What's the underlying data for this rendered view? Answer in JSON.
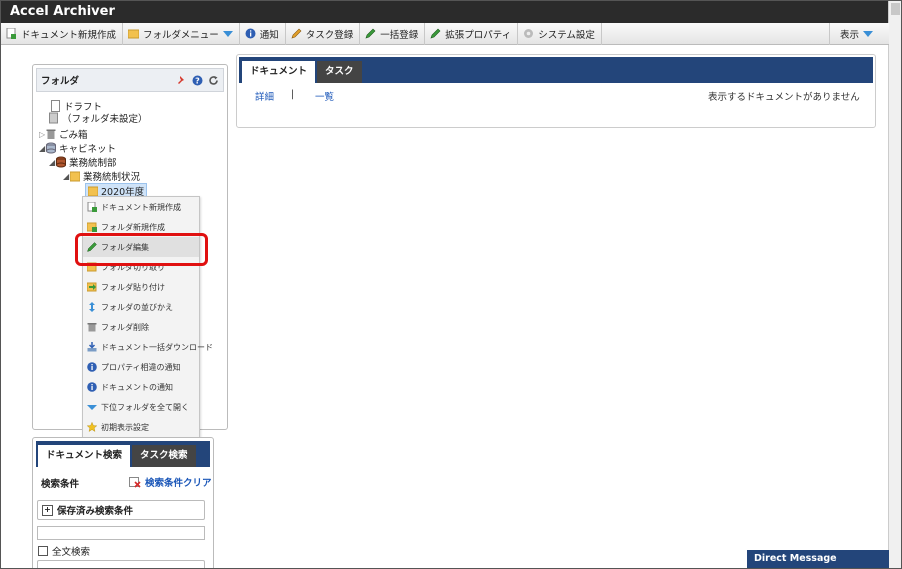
{
  "app": {
    "title": "Accel Archiver"
  },
  "toolbar": {
    "items": [
      {
        "label": "ドキュメント新規作成",
        "icon": "new-document-icon"
      },
      {
        "label": "フォルダメニュー",
        "icon": "folder-icon"
      },
      {
        "label": "通知",
        "icon": "info-icon"
      },
      {
        "label": "タスク登録",
        "icon": "pencil-icon"
      },
      {
        "label": "一括登録",
        "icon": "pencil-icon"
      },
      {
        "label": "拡張プロパティ",
        "icon": "pencil-icon"
      },
      {
        "label": "システム設定",
        "icon": "gear-icon"
      }
    ],
    "view_label": "表示"
  },
  "folder_panel": {
    "title": "フォルダ",
    "tree": {
      "draft": "ドラフト",
      "unset": "（フォルダ未設定）",
      "trash": "ごみ箱",
      "cabinet": "キャビネット",
      "dept": "業務統制部",
      "status": "業務統制状況",
      "year": "2020年度"
    }
  },
  "context_menu": {
    "items": [
      {
        "label": "ドキュメント新規作成",
        "icon": "new-document-icon"
      },
      {
        "label": "フォルダ新規作成",
        "icon": "new-folder-icon"
      },
      {
        "label": "フォルダ編集",
        "icon": "pencil-icon"
      },
      {
        "label": "フォルダ切り取り",
        "icon": "cut-icon"
      },
      {
        "label": "フォルダ貼り付け",
        "icon": "paste-icon"
      },
      {
        "label": "フォルダの並びかえ",
        "icon": "sort-icon"
      },
      {
        "label": "フォルダ削除",
        "icon": "trash-icon"
      },
      {
        "label": "ドキュメント一括ダウンロード",
        "icon": "download-icon"
      },
      {
        "label": "プロパティ相違の通知",
        "icon": "info-icon"
      },
      {
        "label": "ドキュメントの通知",
        "icon": "info-icon"
      },
      {
        "label": "下位フォルダを全て開く",
        "icon": "expand-icon"
      },
      {
        "label": "初期表示設定",
        "icon": "star-icon"
      }
    ]
  },
  "search_panel": {
    "tabs": [
      "ドキュメント検索",
      "タスク検索"
    ],
    "conditions_label": "検索条件",
    "clear_label": "検索条件クリア",
    "saved_label": "保存済み検索条件",
    "fulltext_label": "全文検索"
  },
  "document_panel": {
    "tabs": [
      "ドキュメント",
      "タスク"
    ],
    "detail_link": "詳細",
    "list_link": "一覧",
    "separator": "|",
    "empty_message": "表示するドキュメントがありません"
  },
  "direct_message": {
    "label": "Direct Message"
  },
  "colors": {
    "accent": "#23457a",
    "highlight": "#e01010",
    "link": "#1a56b8"
  }
}
